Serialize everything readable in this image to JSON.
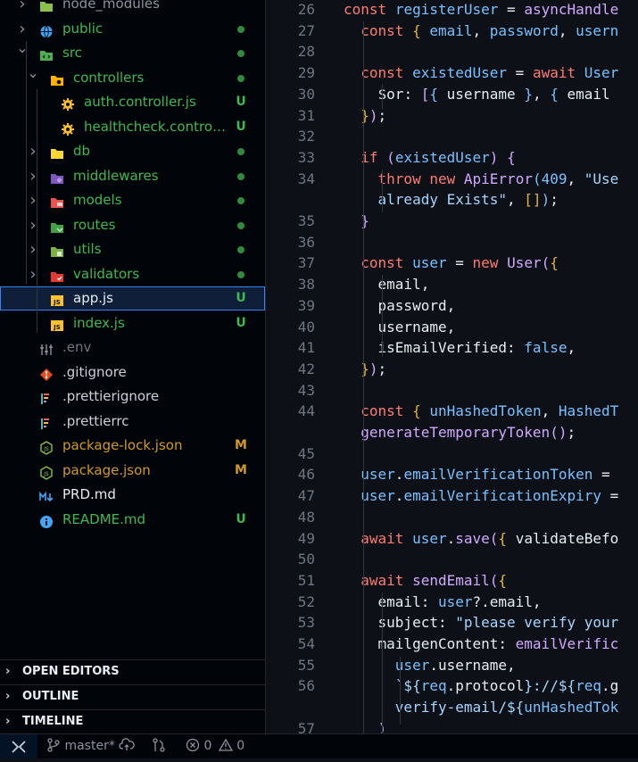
{
  "explorer": {
    "items": [
      {
        "label": "node_modules",
        "type": "folder",
        "icon": "folder-node-icon",
        "color": "#8b949e"
      },
      {
        "label": "public",
        "type": "folder",
        "icon": "folder-public-icon",
        "color": "#3fb950"
      },
      {
        "label": "src",
        "type": "folder-open",
        "icon": "folder-src-icon",
        "color": "#3fb950"
      },
      {
        "label": "controllers",
        "type": "folder-open",
        "icon": "folder-controllers-icon",
        "color": "#3fb950"
      },
      {
        "label": "auth.controller.js",
        "type": "file",
        "icon": "gear-file-icon",
        "color": "#3fb950",
        "badge": "U"
      },
      {
        "label": "healthcheck.controlle...",
        "type": "file",
        "icon": "gear-file-icon",
        "color": "#3fb950",
        "badge": "U"
      },
      {
        "label": "db",
        "type": "folder",
        "icon": "folder-db-icon",
        "color": "#3fb950"
      },
      {
        "label": "middlewares",
        "type": "folder",
        "icon": "folder-middlewares-icon",
        "color": "#3fb950"
      },
      {
        "label": "models",
        "type": "folder",
        "icon": "folder-models-icon",
        "color": "#3fb950"
      },
      {
        "label": "routes",
        "type": "folder",
        "icon": "folder-routes-icon",
        "color": "#3fb950"
      },
      {
        "label": "utils",
        "type": "folder",
        "icon": "folder-utils-icon",
        "color": "#3fb950"
      },
      {
        "label": "validators",
        "type": "folder",
        "icon": "folder-validators-icon",
        "color": "#3fb950"
      },
      {
        "label": "app.js",
        "type": "file",
        "icon": "js-file-icon",
        "color": "#e6edf3",
        "badge": "U",
        "selected": true
      },
      {
        "label": "index.js",
        "type": "file",
        "icon": "js-file-icon",
        "color": "#3fb950",
        "badge": "U"
      },
      {
        "label": ".env",
        "type": "file",
        "icon": "env-file-icon",
        "color": "#6e7681"
      },
      {
        "label": ".gitignore",
        "type": "file",
        "icon": "git-file-icon",
        "color": "#c9d1d9"
      },
      {
        "label": ".prettierignore",
        "type": "file",
        "icon": "prettier-file-icon",
        "color": "#c9d1d9"
      },
      {
        "label": ".prettierrc",
        "type": "file",
        "icon": "prettier-file-icon",
        "color": "#c9d1d9"
      },
      {
        "label": "package-lock.json",
        "type": "file",
        "icon": "nodejs-file-icon",
        "color": "#d29922",
        "badge": "M"
      },
      {
        "label": "package.json",
        "type": "file",
        "icon": "nodejs-file-icon",
        "color": "#d29922",
        "badge": "M"
      },
      {
        "label": "PRD.md",
        "type": "file",
        "icon": "markdown-file-icon",
        "color": "#e6edf3"
      },
      {
        "label": "README.md",
        "type": "file",
        "icon": "info-file-icon",
        "color": "#3fb950",
        "badge": "U"
      }
    ],
    "panels": [
      {
        "label": "OPEN EDITORS",
        "name": "open-editors-panel"
      },
      {
        "label": "OUTLINE",
        "name": "outline-panel"
      },
      {
        "label": "TIMELINE",
        "name": "timeline-panel"
      }
    ]
  },
  "editor": {
    "lines": [
      {
        "n": "26",
        "html": "<span class='kw'>const</span> <span class='vr'>registerUser</span> = <span class='fn'>asyncHandle</span>"
      },
      {
        "n": "27",
        "html": "  <span class='kw'>const</span> <span class='br'>{</span> <span class='vr'>email</span>, <span class='vr'>password</span>, <span class='vr'>usern</span>"
      },
      {
        "n": "28",
        "html": ""
      },
      {
        "n": "29",
        "html": "  <span class='kw'>const</span> <span class='vr'>existedUser</span> = <span class='kw'>await</span> <span class='vr'>User</span>"
      },
      {
        "n": "30",
        "html": "    <span class='pr'>$or</span>: <span class='fn'>[</span><span class='vr'>{</span> username <span class='vr'>}</span>, <span class='vr'>{</span> email"
      },
      {
        "n": "31",
        "html": "  <span class='br'>}</span><span class='fn'>)</span>;"
      },
      {
        "n": "32",
        "html": ""
      },
      {
        "n": "33",
        "html": "  <span class='kw'>if</span> <span class='fn'>(</span><span class='vr'>existedUser</span><span class='fn'>)</span> <span class='fn'>{</span>"
      },
      {
        "n": "34",
        "html": "    <span class='kw'>throw</span> <span class='kw'>new</span> <span class='fn'>ApiError</span><span class='vr'>(</span><span class='num'>409</span>, <span class='str'>\"Use</span>"
      },
      {
        "n": "",
        "html": "    <span class='str'>already Exists\"</span>, <span class='br'>[]</span><span class='vr'>)</span>;"
      },
      {
        "n": "35",
        "html": "  <span class='fn'>}</span>"
      },
      {
        "n": "36",
        "html": ""
      },
      {
        "n": "37",
        "html": "  <span class='kw'>const</span> <span class='vr'>user</span> = <span class='kw'>new</span> <span class='fn'>User</span><span class='fn'>(</span><span class='br'>{</span>"
      },
      {
        "n": "38",
        "html": "    email,"
      },
      {
        "n": "39",
        "html": "    password,"
      },
      {
        "n": "40",
        "html": "    username,"
      },
      {
        "n": "41",
        "html": "    isEmailVerified: <span class='num'>false</span>,"
      },
      {
        "n": "42",
        "html": "  <span class='br'>}</span><span class='fn'>)</span>;"
      },
      {
        "n": "43",
        "html": ""
      },
      {
        "n": "44",
        "html": "  <span class='kw'>const</span> <span class='br'>{</span> <span class='vr'>unHashedToken</span>, <span class='vr'>HashedT</span>"
      },
      {
        "n": "",
        "html": "  <span class='fn'>generateTemporaryToken</span><span class='fn'>()</span>;"
      },
      {
        "n": "45",
        "html": ""
      },
      {
        "n": "46",
        "html": "  <span class='vr'>user</span>.<span class='vr'>emailVerificationToken</span> ="
      },
      {
        "n": "47",
        "html": "  <span class='vr'>user</span>.<span class='vr'>emailVerificationExpiry</span> ="
      },
      {
        "n": "48",
        "html": ""
      },
      {
        "n": "49",
        "html": "  <span class='kw'>await</span> <span class='vr'>user</span>.<span class='fn'>save</span><span class='fn'>(</span><span class='br'>{</span> validateBefo"
      },
      {
        "n": "50",
        "html": ""
      },
      {
        "n": "51",
        "html": "  <span class='kw'>await</span> <span class='fn'>sendEmail</span><span class='fn'>(</span><span class='br'>{</span>"
      },
      {
        "n": "52",
        "html": "    email: <span class='vr'>user</span>?.email,"
      },
      {
        "n": "53",
        "html": "    subject: <span class='str'>\"please verify your</span>"
      },
      {
        "n": "54",
        "html": "    mailgenContent: <span class='fn'>emailVerific</span>"
      },
      {
        "n": "55",
        "html": "      <span class='vr'>user</span>.username,"
      },
      {
        "n": "56",
        "html": "      <span class='str'>`${</span><span class='vr'>req</span>.protocol<span class='str'>}://${</span><span class='vr'>req</span>.g"
      },
      {
        "n": "",
        "html": "      <span class='str'>verify-email/${</span><span class='vr'>unHashedTok</span>"
      },
      {
        "n": "57",
        "html": "    <span class='fn'>)</span>"
      }
    ]
  },
  "status": {
    "branch": "master*",
    "errors": "0",
    "warnings": "0",
    "remote_icon": "remote-icon",
    "accent": "#1f6feb"
  }
}
